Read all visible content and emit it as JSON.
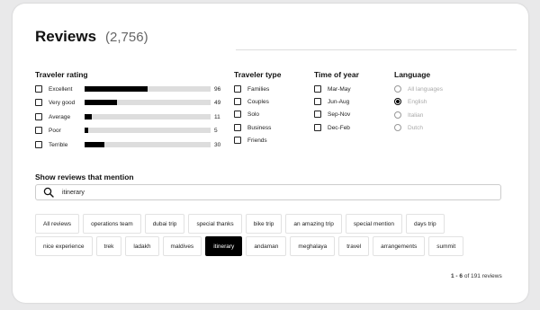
{
  "reviews": {
    "title": "Reviews",
    "count": "(2,756)"
  },
  "traveler_rating": {
    "title": "Traveler rating",
    "items": [
      {
        "label": "Excellent",
        "count": "96",
        "fraction": 0.5
      },
      {
        "label": "Very good",
        "count": "49",
        "fraction": 0.26
      },
      {
        "label": "Average",
        "count": "11",
        "fraction": 0.06
      },
      {
        "label": "Poor",
        "count": "5",
        "fraction": 0.03
      },
      {
        "label": "Terrible",
        "count": "30",
        "fraction": 0.16
      }
    ]
  },
  "traveler_type": {
    "title": "Traveler type",
    "items": [
      "Families",
      "Couples",
      "Solo",
      "Business",
      "Friends"
    ]
  },
  "time_of_year": {
    "title": "Time of year",
    "items": [
      "Mar-May",
      "Jun-Aug",
      "Sep-Nov",
      "Dec-Feb"
    ]
  },
  "language": {
    "title": "Language",
    "items": [
      "All languages",
      "English",
      "Italian",
      "Dutch"
    ],
    "selected": "English"
  },
  "mention": {
    "title": "Show reviews that mention",
    "search_value": "itinerary",
    "chips_row1": [
      "All reviews",
      "operations team",
      "dubai trip",
      "special thanks",
      "bike trip",
      "an amazing trip",
      "special mention",
      "days trip"
    ],
    "chips_row2": [
      "nice experience",
      "trek",
      "ladakh",
      "maldives",
      "itinerary",
      "andaman",
      "meghalaya",
      "travel",
      "arrangements",
      "summit"
    ],
    "active_chip": "itinerary"
  },
  "pagination": {
    "range": "1 - 6",
    "rest": "of 191 reviews"
  },
  "colors": {
    "accent": "#000000",
    "bar_track": "#dddddd"
  }
}
